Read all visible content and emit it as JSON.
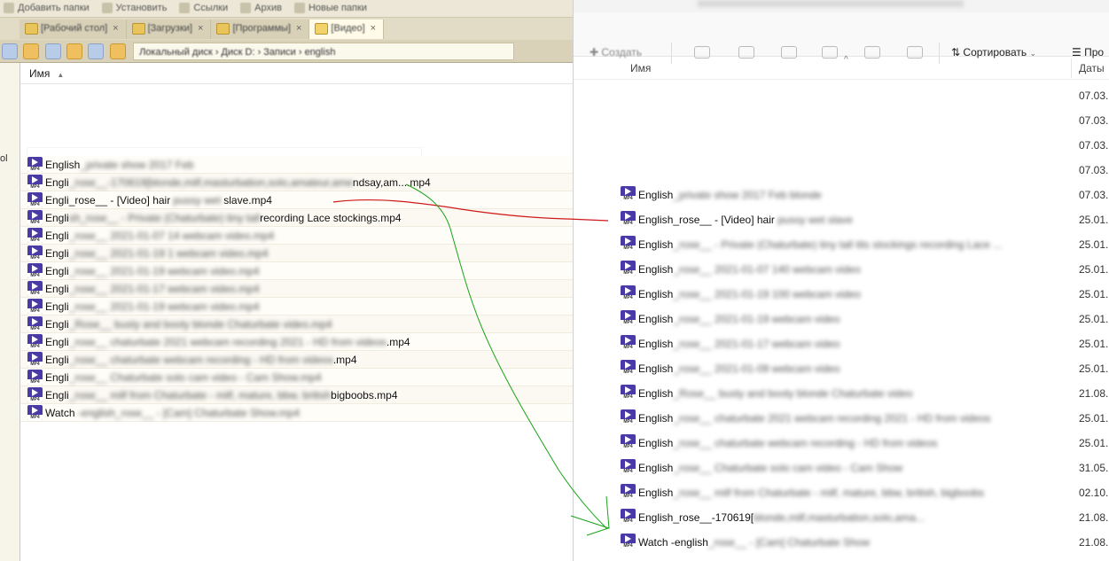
{
  "left": {
    "bookmarks": [
      "Добавить папки",
      "Установить",
      "Ссылки",
      "Архив",
      "Новые папки"
    ],
    "tabs": [
      {
        "label": "[Рабочий стол]",
        "active": false
      },
      {
        "label": "[Загрузки]",
        "active": false
      },
      {
        "label": "[Программы]",
        "active": false
      },
      {
        "label": "[Видео]",
        "active": true
      }
    ],
    "breadcrumb": "Локальный диск  ›  Диск D:  ›  Записи  ›  english",
    "column_name": "Имя",
    "files": [
      {
        "prefix": "English",
        "rest": "_private show 2017 Feb"
      },
      {
        "prefix": "Engli",
        "rest": "_rose__-170619[blo",
        "tail": "nde,milf,masturbation,solo,amateur,ame",
        "suffix": "ndsay,am....mp4"
      },
      {
        "prefix": "Engli",
        "mid": "_rose__ - [Video] hair ",
        "rest": "pussy wet",
        "suffix": " slave.mp4"
      },
      {
        "prefix": "Engli",
        "rest": "sh_rose__ - Private (Chaturbate) tiny tall",
        "suffix": "recording Lace stockings.mp4"
      },
      {
        "prefix": "Engli",
        "rest": "_rose__ 2021-01-07 14 webcam video.mp4"
      },
      {
        "prefix": "Engli",
        "rest": "_rose__ 2021-01-19 1 webcam video.mp4"
      },
      {
        "prefix": "Engli",
        "rest": "_rose__ 2021-01-19 webcam video.mp4"
      },
      {
        "prefix": "Engli",
        "rest": "_rose__ 2021-01-17 webcam video.mp4"
      },
      {
        "prefix": "Engli",
        "rest": "_rose__ 2021-01-19 webcam video.mp4"
      },
      {
        "prefix": "Engli",
        "rest": "_Rose__ busty and booty blonde Chaturbate video.mp4"
      },
      {
        "prefix": "Engli",
        "rest": "_rose__ chaturbate 2021 webcam recording 2021 - HD from videos",
        "suffix": ".mp4"
      },
      {
        "prefix": "Engli",
        "rest": "_rose__ chaturbate webcam recording - HD from videos",
        "suffix": ".mp4"
      },
      {
        "prefix": "Engli",
        "rest": "_rose__ Chaturbate solo cam video - Cam Show.mp4"
      },
      {
        "prefix": "Engli",
        "rest": "_rose__ milf from Chaturbate - milf, mature, bbw, british",
        "suffix": "bigboobs.mp4"
      },
      {
        "prefix": "Watch",
        "rest": " -english_rose__ - [Cam] Chaturbate Show.mp4"
      }
    ]
  },
  "gutter": {
    "text": "ol"
  },
  "right": {
    "new_button": "Создать",
    "sort_button": "Сортировать",
    "view_button": "Про",
    "column_name": "Имя",
    "column_date": "Даты",
    "rows": [
      {
        "empty": true,
        "date": "07.03."
      },
      {
        "empty": true,
        "date": "07.03."
      },
      {
        "empty": true,
        "date": "07.03."
      },
      {
        "empty": true,
        "date": "07.03."
      },
      {
        "prefix": "English",
        "rest": "_private show 2017 Feb blonde",
        "date": "07.03."
      },
      {
        "prefix": "Englis",
        "mid": "h_rose__ - [Video] hair ",
        "rest": "pussy wet slave",
        "date": "25.01."
      },
      {
        "prefix": "English",
        "rest": "_rose__ - Private (Chaturbate) tiny tall tits stockings recording Lace ...",
        "date": "25.01."
      },
      {
        "prefix": "English",
        "rest": "_rose__ 2021-01-07 140 webcam video",
        "date": "25.01."
      },
      {
        "prefix": "English",
        "rest": "_rose__ 2021-01-19 100 webcam video",
        "date": "25.01."
      },
      {
        "prefix": "English",
        "rest": "_rose__ 2021-01-19 webcam video",
        "date": "25.01."
      },
      {
        "prefix": "English",
        "rest": "_rose__ 2021-01-17 webcam video",
        "date": "25.01."
      },
      {
        "prefix": "English",
        "rest": "_rose__ 2021-01-09 webcam video",
        "date": "25.01."
      },
      {
        "prefix": "English",
        "rest": "_Rose__ busty and booty blonde Chaturbate video",
        "date": "21.08."
      },
      {
        "prefix": "English",
        "rest": "_rose__ chaturbate 2021 webcam recording 2021 - HD from videos",
        "date": "25.01."
      },
      {
        "prefix": "English",
        "rest": "_rose__ chaturbate webcam recording - HD from videos",
        "date": "25.01."
      },
      {
        "prefix": "English",
        "rest": "_rose__ Chaturbate solo cam video - Cam Show",
        "date": "31.05."
      },
      {
        "prefix": "English",
        "rest": "_rose__ milf from Chaturbate - milf, mature, bbw, british, bigboobs",
        "date": "02.10."
      },
      {
        "prefix": "English",
        "mid": "_rose__-170619[",
        "rest": "blonde,milf,masturbation,solo,ama...",
        "date": "21.08."
      },
      {
        "prefix": "Watch -english",
        "rest": "_rose__ - [Cam] Chaturbate Show",
        "date": "21.08."
      }
    ]
  },
  "annotation_colors": {
    "red": "#d01818",
    "green": "#17a417"
  }
}
